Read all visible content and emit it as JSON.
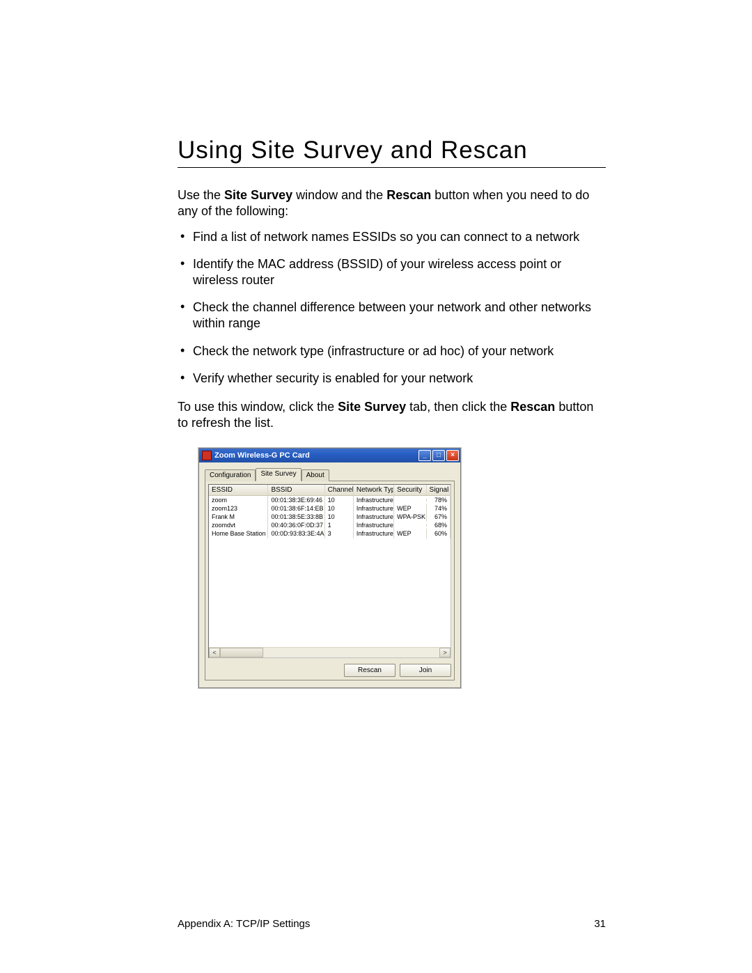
{
  "heading": "Using Site Survey and Rescan",
  "intro": {
    "pre": "Use the ",
    "b1": "Site Survey",
    "mid": " window and the ",
    "b2": "Rescan",
    "post": " button when you need to do any of the following:"
  },
  "bullets": [
    "Find a list of network names ESSIDs so you can connect to a network",
    "Identify the MAC address (BSSID) of your wireless access point or wireless router",
    "Check the channel difference between your network and other networks within range",
    "Check the network type (infrastructure or ad hoc) of your network",
    "Verify whether security is enabled for your network"
  ],
  "instr": {
    "pre": "To use this window, click the ",
    "b1": "Site Survey",
    "mid": " tab, then click the ",
    "b2": "Rescan",
    "post": " button to refresh the list."
  },
  "window": {
    "title": "Zoom Wireless-G PC Card",
    "tabs": {
      "config": "Configuration",
      "survey": "Site Survey",
      "about": "About"
    },
    "columns": {
      "essid": "ESSID",
      "bssid": "BSSID",
      "channel": "Channel",
      "ntype": "Network Type",
      "security": "Security",
      "signal": "Signal"
    },
    "rows": [
      {
        "essid": "zoom",
        "bssid": "00:01:38:3E:69:46",
        "channel": "10",
        "ntype": "Infrastructure",
        "security": "",
        "signal": "78%"
      },
      {
        "essid": "zoom123",
        "bssid": "00:01:38:6F:14:EB",
        "channel": "10",
        "ntype": "Infrastructure",
        "security": "WEP",
        "signal": "74%"
      },
      {
        "essid": "Frank M",
        "bssid": "00:01:38:5E:33:8B",
        "channel": "10",
        "ntype": "Infrastructure",
        "security": "WPA-PSK",
        "signal": "67%"
      },
      {
        "essid": "zoomdvt",
        "bssid": "00:40:36:0F:0D:37",
        "channel": "1",
        "ntype": "Infrastructure",
        "security": "",
        "signal": "68%"
      },
      {
        "essid": "Home Base Station",
        "bssid": "00:0D:93:83:3E:4A",
        "channel": "3",
        "ntype": "Infrastructure",
        "security": "WEP",
        "signal": "60%"
      }
    ],
    "buttons": {
      "rescan": "Rescan",
      "join": "Join"
    }
  },
  "footer": {
    "left": "Appendix A: TCP/IP Settings",
    "right": "31"
  }
}
